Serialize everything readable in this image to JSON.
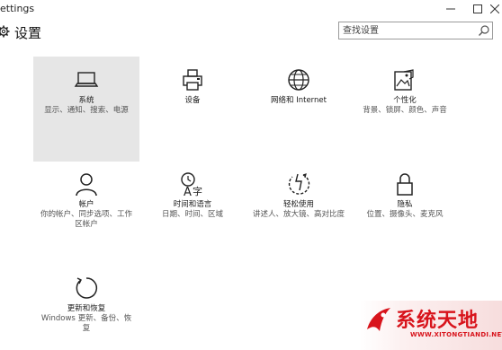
{
  "window": {
    "title": "ettings",
    "minimize_icon": "minimize-icon",
    "maximize_icon": "maximize-icon",
    "close_icon": "close-icon"
  },
  "header": {
    "title": "设置",
    "icon": "gear-icon"
  },
  "search": {
    "placeholder": "查找设置",
    "value": ""
  },
  "tiles": [
    {
      "id": "system",
      "icon": "laptop-icon",
      "name": "系统",
      "desc": "显示、通知、搜索、电源",
      "selected": true
    },
    {
      "id": "devices",
      "icon": "printer-icon",
      "name": "设备",
      "desc": "",
      "selected": false
    },
    {
      "id": "network",
      "icon": "globe-icon",
      "name": "网络和 Internet",
      "desc": "",
      "selected": false
    },
    {
      "id": "personalization",
      "icon": "personalize-icon",
      "name": "个性化",
      "desc": "背景、锁屏、颜色、声音",
      "selected": false
    },
    {
      "id": "accounts",
      "icon": "person-icon",
      "name": "帐户",
      "desc": "你的帐户、同步选项、工作区帐户",
      "selected": false
    },
    {
      "id": "time-language",
      "icon": "time-language-icon",
      "name": "时间和语言",
      "desc": "日期、时间、区域",
      "selected": false
    },
    {
      "id": "ease-of-access",
      "icon": "ease-of-access-icon",
      "name": "轻松使用",
      "desc": "讲述人、放大镜、高对比度",
      "selected": false
    },
    {
      "id": "privacy",
      "icon": "lock-icon",
      "name": "隐私",
      "desc": "位置、摄像头、麦克风",
      "selected": false
    },
    {
      "id": "update-security",
      "icon": "refresh-icon",
      "name": "更新和恢复",
      "desc": "Windows 更新、备份、恢复",
      "selected": false
    }
  ],
  "watermark": {
    "title": "系统天地",
    "url": "WWW.XITONGTIANDI.NET",
    "color": "#d8141c"
  },
  "colors": {
    "selected_tile": "#e6e6e6",
    "background": "#ffffff"
  }
}
